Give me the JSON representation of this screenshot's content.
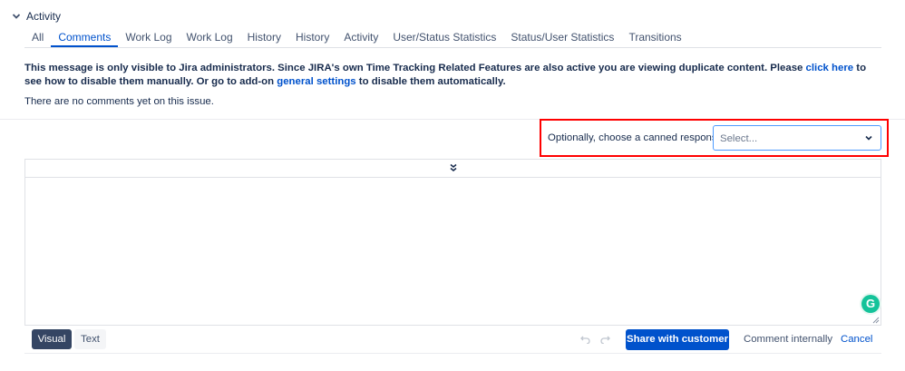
{
  "section": {
    "title": "Activity"
  },
  "tabs": [
    {
      "label": "All",
      "active": false
    },
    {
      "label": "Comments",
      "active": true
    },
    {
      "label": "Work Log",
      "active": false
    },
    {
      "label": "Work Log",
      "active": false
    },
    {
      "label": "History",
      "active": false
    },
    {
      "label": "History",
      "active": false
    },
    {
      "label": "Activity",
      "active": false
    },
    {
      "label": "User/Status Statistics",
      "active": false
    },
    {
      "label": "Status/User Statistics",
      "active": false
    },
    {
      "label": "Transitions",
      "active": false
    }
  ],
  "notice": {
    "part1": "This message is only visible to Jira administrators. Since JIRA's own Time Tracking Related Features are also active you are viewing duplicate content. Please ",
    "link1": "click here",
    "part2": " to see how to disable them manually. Or go to add-on ",
    "link2": "general settings",
    "part3": " to disable them automatically."
  },
  "empty_message": "There are no comments yet on this issue.",
  "canned": {
    "label": "Optionally, choose a canned response:",
    "placeholder": "Select..."
  },
  "editor": {
    "mode_visual": "Visual",
    "mode_text": "Text",
    "grammarly": "G"
  },
  "actions": {
    "share": "Share with customer",
    "internal": "Comment internally",
    "cancel": "Cancel"
  },
  "colors": {
    "link": "#0052cc",
    "primary": "#0052cc",
    "highlight": "#ff0000",
    "grammarly": "#15c39a"
  }
}
